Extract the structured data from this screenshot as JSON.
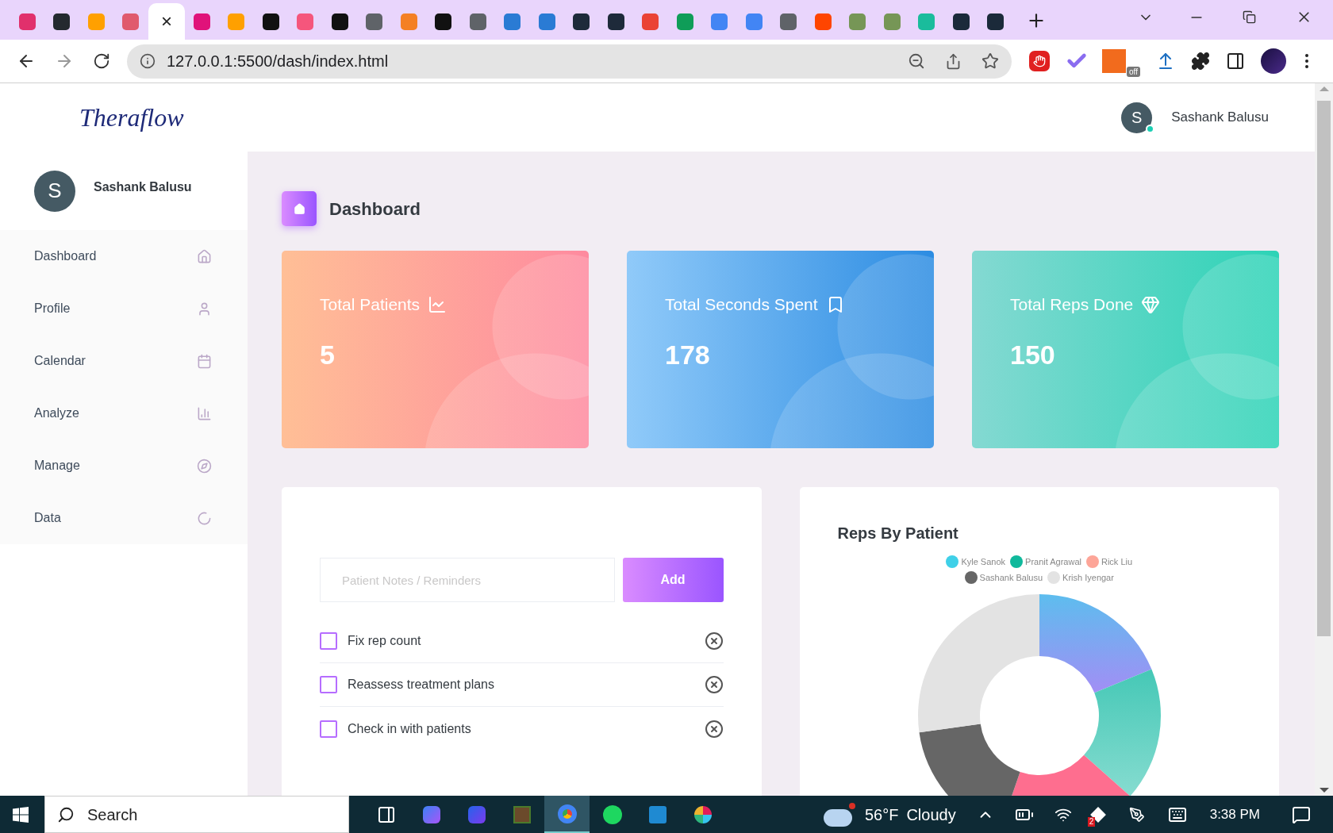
{
  "browser": {
    "tabs": [
      {
        "selected": false,
        "color": "#e1306c"
      },
      {
        "selected": false,
        "color": "#24292f"
      },
      {
        "selected": false,
        "color": "#ffa000"
      },
      {
        "selected": false,
        "color": "#e05a6d"
      },
      {
        "selected": true,
        "close": "×"
      },
      {
        "selected": false,
        "color": "#e0127a"
      },
      {
        "selected": false,
        "color": "#ffa000"
      },
      {
        "selected": false,
        "color": "#111111"
      },
      {
        "selected": false,
        "color": "#f5567c"
      },
      {
        "selected": false,
        "color": "#111111"
      },
      {
        "selected": false,
        "color": "#5f6368"
      },
      {
        "selected": false,
        "color": "#f48024"
      },
      {
        "selected": false,
        "color": "#111111"
      },
      {
        "selected": false,
        "color": "#5f6368"
      },
      {
        "selected": false,
        "color": "#2a7bd4"
      },
      {
        "selected": false,
        "color": "#2a7bd4"
      },
      {
        "selected": false,
        "color": "#1e2a3a"
      },
      {
        "selected": false,
        "color": "#1e2a3a"
      },
      {
        "selected": false,
        "color": "#ea4335"
      },
      {
        "selected": false,
        "color": "#0f9d58"
      },
      {
        "selected": false,
        "color": "#4285f4"
      },
      {
        "selected": false,
        "color": "#4285f4"
      },
      {
        "selected": false,
        "color": "#5f6368"
      },
      {
        "selected": false,
        "color": "#ff4500"
      },
      {
        "selected": false,
        "color": "#769656"
      },
      {
        "selected": false,
        "color": "#769656"
      },
      {
        "selected": false,
        "color": "#1abc9c"
      },
      {
        "selected": false,
        "color": "#1b2a3a"
      },
      {
        "selected": false,
        "color": "#1b2a3a"
      }
    ],
    "url": "127.0.0.1:5500/dash/index.html",
    "extension_badge": "off"
  },
  "header": {
    "logo": "Theraflow",
    "user": {
      "initial": "S",
      "name": "Sashank Balusu",
      "online": true
    }
  },
  "sidebar": {
    "profile": {
      "initial": "S",
      "name": "Sashank Balusu"
    },
    "items": [
      {
        "label": "Dashboard"
      },
      {
        "label": "Profile"
      },
      {
        "label": "Calendar"
      },
      {
        "label": "Analyze"
      },
      {
        "label": "Manage"
      },
      {
        "label": "Data"
      }
    ]
  },
  "page_title": "Dashboard",
  "stats": [
    {
      "title": "Total Patients",
      "value": "5",
      "kind": "danger"
    },
    {
      "title": "Total Seconds Spent",
      "value": "178",
      "kind": "info"
    },
    {
      "title": "Total Reps Done",
      "value": "150",
      "kind": "success"
    }
  ],
  "todo": {
    "placeholder": "Patient Notes / Reminders",
    "button": "Add",
    "items": [
      {
        "text": "Fix rep count",
        "checked": false
      },
      {
        "text": "Reassess treatment plans",
        "checked": false
      },
      {
        "text": "Check in with patients",
        "checked": false
      }
    ]
  },
  "chart_card": {
    "title": "Reps By Patient",
    "legend": [
      {
        "name": "Kyle Sanok",
        "color": "#3fd0e8"
      },
      {
        "name": "Pranit Agrawal",
        "color": "#10b99c"
      },
      {
        "name": "Rick Liu",
        "color": "#fda598"
      },
      {
        "name": "Sashank Balusu",
        "color": "#666666"
      },
      {
        "name": "Krish Iyengar",
        "color": "#e3e3e3"
      }
    ]
  },
  "taskbar": {
    "search": "Search",
    "temperature": "56°F",
    "weather": "Cloudy",
    "tray_badge": "2",
    "time": "3:38 PM"
  }
}
